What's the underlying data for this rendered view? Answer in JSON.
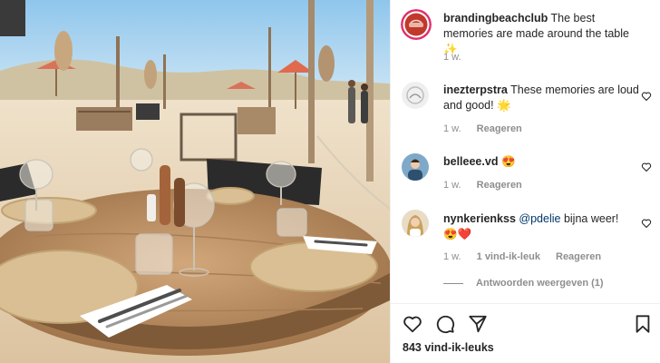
{
  "post": {
    "caption": {
      "username": "brandingbeachclub",
      "text": "The best memories are made around the table",
      "emoji": "✨",
      "time": "1 w."
    },
    "comments": [
      {
        "username": "inezterpstra",
        "text": "These memories are loud and good!",
        "emoji": "🌟",
        "time": "1 w.",
        "reply_label": "Reageren"
      },
      {
        "username": "belleee.vd",
        "text": "",
        "emoji": "😍",
        "time": "1 w.",
        "reply_label": "Reageren"
      },
      {
        "username": "nynkerienkss",
        "mention": "@pdelie",
        "text": "bijna weer!",
        "emoji": "😍❤️",
        "time": "1 w.",
        "likes_label": "1 vind-ik-leuk",
        "reply_label": "Reageren",
        "view_replies": "Antwoorden weergeven (1)"
      }
    ],
    "likes": "843 vind-ik-leuks"
  },
  "colors": {
    "text": "#262626",
    "muted": "#8e8e8e",
    "mention": "#00376b",
    "sky": "#a9d3ee",
    "sand": "#e7d3b4",
    "table_wood": "#b88d62"
  },
  "icons": {
    "like": "heart-icon",
    "comment": "comment-icon",
    "share": "share-icon",
    "save": "bookmark-icon"
  }
}
